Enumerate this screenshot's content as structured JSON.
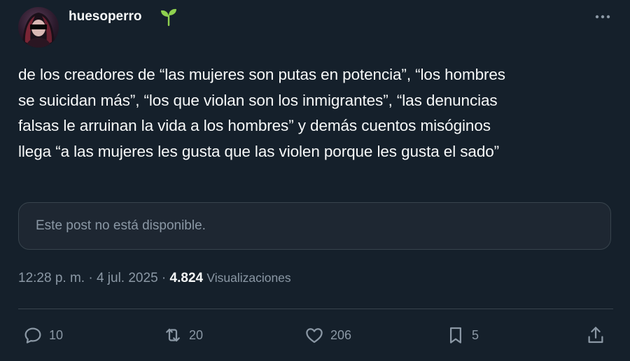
{
  "author": {
    "username": "huesoperro",
    "badge_icon": "sprout-icon"
  },
  "post": {
    "text": "de los creadores de “las mujeres son putas en potencia”, “los hombres\nse suicidan más”, “los que violan son los inmigrantes”, “las denuncias\nfalsas le arruinan la vida a los hombres” y demás cuentos misóginos\nllega “a las mujeres les gusta que las violen porque les gusta el sado”",
    "quoted_unavailable": "Este post no está disponible.",
    "time": "12:28 p. m.",
    "separator": "·",
    "date": "4 jul. 2025",
    "views_count": "4.824",
    "views_label": "Visualizaciones"
  },
  "actions": {
    "replies": "10",
    "reposts": "20",
    "likes": "206",
    "bookmarks": "5"
  },
  "colors": {
    "background": "#15202b",
    "text": "#f7f9f9",
    "secondary": "#8b98a5",
    "border": "#38444d",
    "badge": "#8fd14f"
  }
}
